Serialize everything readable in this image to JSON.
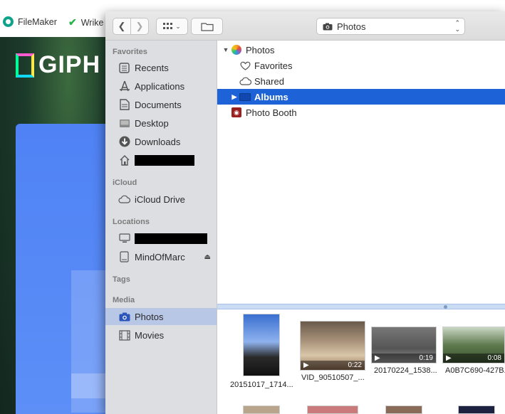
{
  "bookmarks": [
    {
      "label": "FileMaker",
      "icon": "filemaker-icon"
    },
    {
      "label": "Wrike",
      "icon": "wrike-check-icon"
    }
  ],
  "background": {
    "logo_text": "GIPH"
  },
  "toolbar": {
    "location": "Photos",
    "location_icon": "camera-icon"
  },
  "sidebar": {
    "favorites_header": "Favorites",
    "favorites": [
      {
        "label": "Recents",
        "icon": "recents-icon"
      },
      {
        "label": "Applications",
        "icon": "applications-icon"
      },
      {
        "label": "Documents",
        "icon": "documents-icon"
      },
      {
        "label": "Desktop",
        "icon": "desktop-icon"
      },
      {
        "label": "Downloads",
        "icon": "downloads-icon"
      },
      {
        "label": "",
        "icon": "home-icon"
      }
    ],
    "icloud_header": "iCloud",
    "icloud": [
      {
        "label": "iCloud Drive",
        "icon": "cloud-icon"
      }
    ],
    "locations_header": "Locations",
    "locations": [
      {
        "label": "",
        "icon": "computer-icon"
      },
      {
        "label": "MindOfMarc",
        "icon": "disk-icon"
      }
    ],
    "tags_header": "Tags",
    "media_header": "Media",
    "media": [
      {
        "label": "Photos",
        "icon": "camera-icon"
      },
      {
        "label": "Movies",
        "icon": "film-icon"
      }
    ]
  },
  "filelist": {
    "rows": [
      {
        "label": "Photos",
        "icon": "photos-app-icon",
        "expanded": true
      },
      {
        "label": "Favorites",
        "icon": "heart-icon"
      },
      {
        "label": "Shared",
        "icon": "cloud-icon"
      },
      {
        "label": "Albums",
        "icon": "folder-icon",
        "selected": true
      },
      {
        "label": "Photo Booth",
        "icon": "photo-booth-icon"
      }
    ]
  },
  "thumbnails": [
    {
      "label": "20151017_1714...",
      "duration": ""
    },
    {
      "label": "VID_90510507_...",
      "duration": "0:22"
    },
    {
      "label": "20170224_1538...",
      "duration": "0:19"
    },
    {
      "label": "A0B7C690-427B...",
      "duration": "0:08"
    }
  ]
}
